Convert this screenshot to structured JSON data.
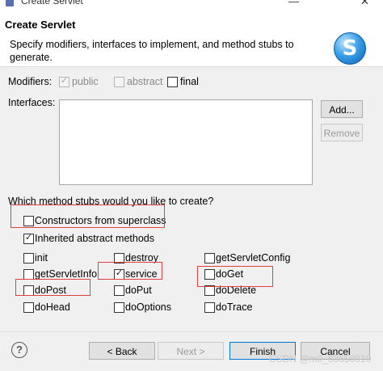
{
  "window": {
    "title": "Create Servlet",
    "controls": {
      "minimize": "—",
      "close": "✕"
    }
  },
  "header": {
    "title": "Create Servlet",
    "description": "Specify modifiers, interfaces to implement, and method stubs to generate.",
    "logo_letter": "S"
  },
  "modifiers": {
    "label": "Modifiers:",
    "options": [
      {
        "label": "public",
        "checked": true,
        "enabled": false
      },
      {
        "label": "abstract",
        "checked": false,
        "enabled": false
      },
      {
        "label": "final",
        "checked": false,
        "enabled": true
      }
    ]
  },
  "interfaces": {
    "label": "Interfaces:",
    "add_label": "Add...",
    "remove_label": "Remove"
  },
  "stubs": {
    "question": "Which method stubs would you like to create?",
    "constructors": {
      "label": "Constructors from superclass",
      "checked": false
    },
    "inherited": {
      "label": "Inherited abstract methods",
      "checked": true
    },
    "methods": [
      {
        "label": "init",
        "checked": false
      },
      {
        "label": "destroy",
        "checked": false
      },
      {
        "label": "getServletConfig",
        "checked": false
      },
      {
        "label": "getServletInfo",
        "checked": false
      },
      {
        "label": "service",
        "checked": true
      },
      {
        "label": "doGet",
        "checked": false
      },
      {
        "label": "doPost",
        "checked": false
      },
      {
        "label": "doPut",
        "checked": false
      },
      {
        "label": "doDelete",
        "checked": false
      },
      {
        "label": "doHead",
        "checked": false
      },
      {
        "label": "doOptions",
        "checked": false
      },
      {
        "label": "doTrace",
        "checked": false
      }
    ]
  },
  "footer": {
    "help": "?",
    "back_label": "< Back",
    "next_label": "Next >",
    "finish_label": "Finish",
    "cancel_label": "Cancel"
  },
  "watermark": "CSDN @m0_63650810",
  "colors": {
    "highlight": "#e04040",
    "accent": "#0078d7"
  }
}
